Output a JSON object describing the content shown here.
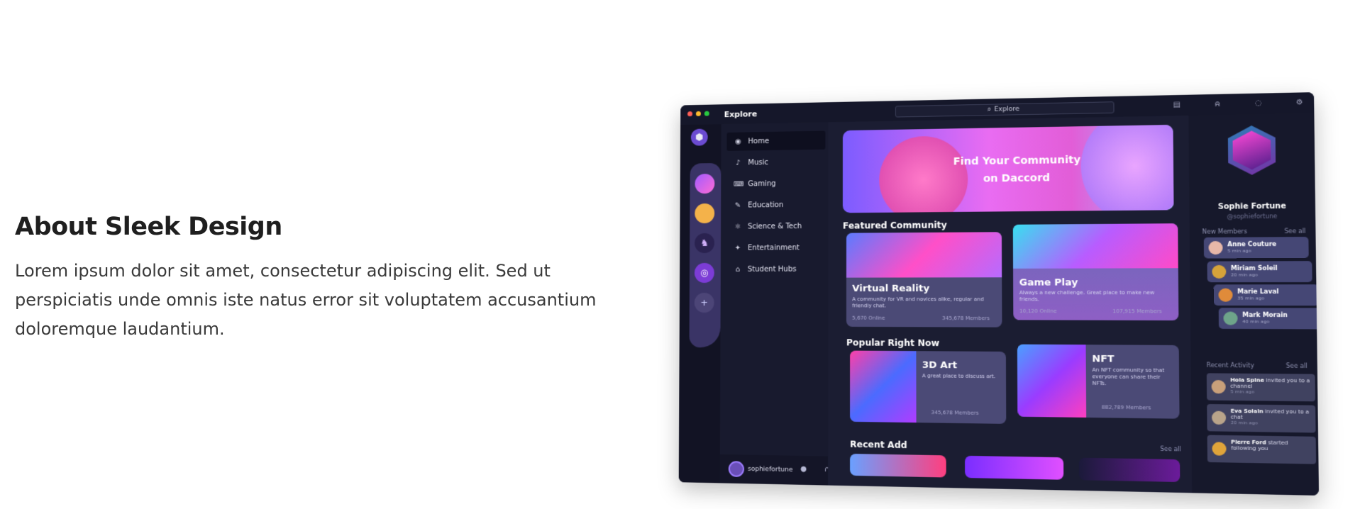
{
  "about": {
    "title": "About Sleek Design",
    "body": "Lorem ipsum dolor sit amet, consectetur adipiscing elit. Sed ut perspiciatis unde omnis iste natus error sit voluptatem accusantium doloremque laudantium."
  },
  "app": {
    "title": "Explore",
    "search_placeholder": "Explore",
    "nav": [
      {
        "icon": "compass-icon",
        "glyph": "◉",
        "label": "Home"
      },
      {
        "icon": "music-icon",
        "glyph": "♪",
        "label": "Music"
      },
      {
        "icon": "gamepad-icon",
        "glyph": "⌨",
        "label": "Gaming"
      },
      {
        "icon": "graduation-cap-icon",
        "glyph": "✎",
        "label": "Education"
      },
      {
        "icon": "atom-icon",
        "glyph": "⚛",
        "label": "Science & Tech"
      },
      {
        "icon": "film-icon",
        "glyph": "✦",
        "label": "Entertainment"
      },
      {
        "icon": "building-icon",
        "glyph": "⌂",
        "label": "Student Hubs"
      }
    ],
    "username": "sophiefortune",
    "hero": "Find Your Community on Daccord",
    "featured_title": "Featured Community",
    "featured": [
      {
        "title": "Virtual Reality",
        "desc": "A community for VR and novices alike, regular and friendly chat.",
        "online": "5,670 Online",
        "members": "345,678 Members"
      },
      {
        "title": "Game Play",
        "desc": "Always a new challenge. Great place to make new friends.",
        "online": "10,120 Online",
        "members": "107,915 Members"
      }
    ],
    "popular_title": "Popular Right Now",
    "popular": [
      {
        "title": "3D Art",
        "desc": "A great place to discuss art.",
        "members": "345,678 Members"
      },
      {
        "title": "NFT",
        "desc": "An NFT community so that everyone can share their NFTs.",
        "members": "882,789 Members"
      }
    ],
    "recent_title": "Recent Add",
    "see_all": "See all",
    "profile": {
      "name": "Sophie Fortune",
      "handle": "@sophiefortune"
    },
    "new_members_label": "New Members",
    "members": [
      {
        "name": "Anne Couture",
        "time": "5 min ago",
        "color": "#e7b7a8"
      },
      {
        "name": "Miriam Soleil",
        "time": "20 min ago",
        "color": "#d6a33a"
      },
      {
        "name": "Marie Laval",
        "time": "35 min ago",
        "color": "#e08b3a"
      },
      {
        "name": "Mark Morain",
        "time": "40 min ago",
        "color": "#6ea48a"
      }
    ],
    "recent_activity_label": "Recent Activity",
    "activity": [
      {
        "name": "Hola Spine",
        "text": "invited you to a channel",
        "time": "5 min ago",
        "color": "#c9a07a"
      },
      {
        "name": "Eva Solain",
        "text": "invited you to a chat",
        "time": "20 min ago",
        "color": "#b9a48a"
      },
      {
        "name": "Pierre Ford",
        "text": "started following you",
        "time": "",
        "color": "#e0a43a"
      }
    ]
  }
}
